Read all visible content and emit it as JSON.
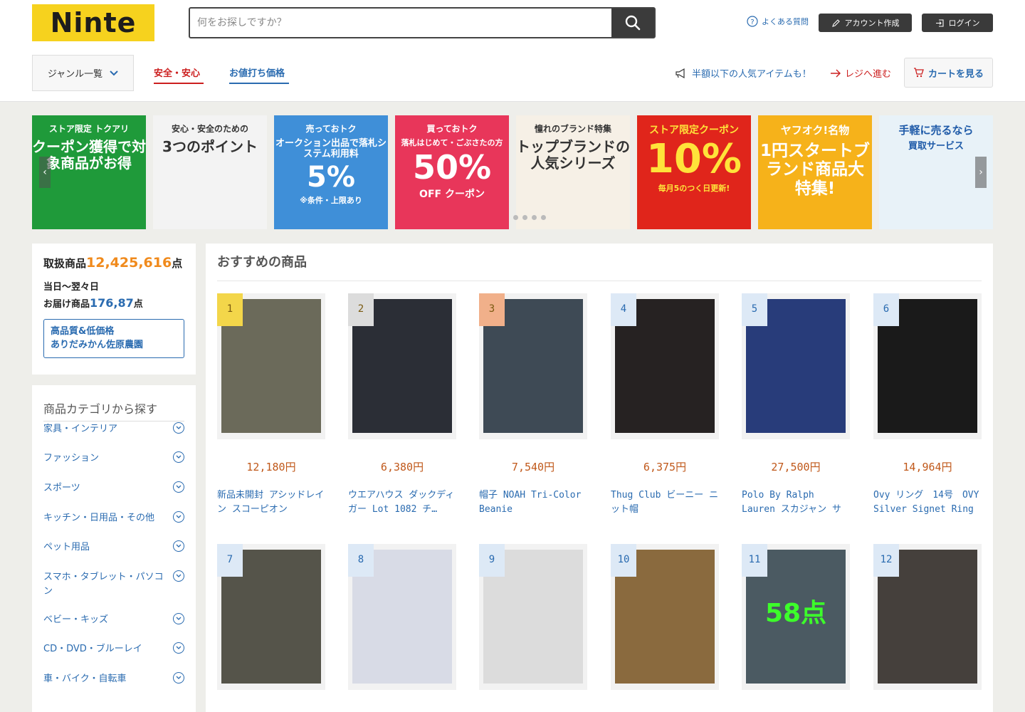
{
  "header": {
    "logo": "Ninte",
    "search_placeholder": "何をお探しですか？",
    "faq": "よくある質問",
    "account_button": "アカウント作成",
    "login_button": "ログイン"
  },
  "nav": {
    "genre": "ジャンル一覧",
    "safe": "安全・安心",
    "price": "お値打ち価格",
    "promo": "半額以下の人気アイテムも！",
    "register": "レジへ進む",
    "cart": "カートを見る"
  },
  "banners": [
    {
      "t1": "ストア限定 トクアリ",
      "t2": "クーポン獲得で対象商品がお得",
      "bg": "#1f9a3a",
      "fg": "#ffffff"
    },
    {
      "t1": "安心・安全のための",
      "t2": "3つのポイント",
      "bg": "#f3f3f3",
      "fg": "#333333"
    },
    {
      "t1": "売っておトク",
      "t2": "オークション出品で落札システム利用料",
      "t3": "5%",
      "t4": "※条件・上限あり",
      "bg": "#3f8fd8",
      "fg": "#ffffff"
    },
    {
      "t1": "買っておトク",
      "t2": "落札はじめて・ごぶさたの方",
      "t3": "50%",
      "t4": "OFF クーポン",
      "bg": "#e8365a",
      "fg": "#ffffff"
    },
    {
      "t1": "憧れのブランド特集",
      "t2": "トップブランドの人気シリーズ",
      "bg": "#f6f0e6",
      "fg": "#333333"
    },
    {
      "t1": "ストア限定クーポン",
      "t3": "10%",
      "t4": "毎月5のつく日更新!",
      "bg": "#e0251b",
      "fg": "#ffe33a"
    },
    {
      "t1": "ヤフオク!名物",
      "t2": "1円スタートブランド商品大特集!",
      "bg": "#f6b21a",
      "fg": "#ffffff"
    },
    {
      "t1": "手軽に売るなら",
      "t2": "買取サービス",
      "bg": "#e8f2f8",
      "fg": "#1e5aa8"
    }
  ],
  "stats": {
    "label1": "取扱商品",
    "count1": "12,425,616",
    "unit1": "点",
    "label2a": "当日〜翌々日",
    "label2b": "お届け商品",
    "count2": "176,87",
    "unit2": "点",
    "quality_line1": "高品質&低価格",
    "quality_line2": "ありだみかん佐原農園"
  },
  "categories": {
    "title": "商品カテゴリから探す",
    "items": [
      "家具・インテリア",
      "ファッション",
      "スポーツ",
      "キッチン・日用品・その他",
      "ペット用品",
      "スマホ・タブレット・パソコン",
      "ベビー・キッズ",
      "CD・DVD・ブルーレイ",
      "車・バイク・自転車"
    ]
  },
  "products": {
    "title": "おすすめの商品",
    "items": [
      {
        "rank": "1",
        "price": "12,180円",
        "name": "新品未開封 アシッドレイン スコーピオン",
        "rank_color": "#f3d64a",
        "img_color": "#6b6a5a"
      },
      {
        "rank": "2",
        "price": "6,380円",
        "name": "ウエアハウス ダックディガー Lot 1082 チ…",
        "rank_color": "#dcdcdc",
        "img_color": "#2b2e36"
      },
      {
        "rank": "3",
        "price": "7,540円",
        "name": "帽子 NOAH Tri-Color Beanie",
        "rank_color": "#f1b08a",
        "img_color": "#3e4a55"
      },
      {
        "rank": "4",
        "price": "6,375円",
        "name": "Thug Club ビーニー ニット帽",
        "rank_color": "#dde9f6",
        "img_color": "#262222"
      },
      {
        "rank": "5",
        "price": "27,500円",
        "name": "Polo By Ralph Lauren スカジャン サテン …",
        "rank_color": "#dde9f6",
        "img_color": "#283c7a"
      },
      {
        "rank": "6",
        "price": "14,964円",
        "name": "Ovy リング　14号　OVY Silver Signet Ring",
        "rank_color": "#dde9f6",
        "img_color": "#1a1a1a"
      },
      {
        "rank": "7",
        "price": "",
        "name": "",
        "rank_color": "#dde9f6",
        "img_color": "#55544a"
      },
      {
        "rank": "8",
        "price": "",
        "name": "",
        "rank_color": "#dde9f6",
        "img_color": "#d8dbe6"
      },
      {
        "rank": "9",
        "price": "",
        "name": "",
        "rank_color": "#dde9f6",
        "img_color": "#dcdcdc"
      },
      {
        "rank": "10",
        "price": "",
        "name": "",
        "rank_color": "#dde9f6",
        "img_color": "#8a6a3e"
      },
      {
        "rank": "11",
        "price": "",
        "name": "",
        "rank_color": "#dde9f6",
        "img_color": "#4b5a62",
        "overlay": "58点"
      },
      {
        "rank": "12",
        "price": "",
        "name": "",
        "rank_color": "#dde9f6",
        "img_color": "#45403c"
      }
    ]
  }
}
